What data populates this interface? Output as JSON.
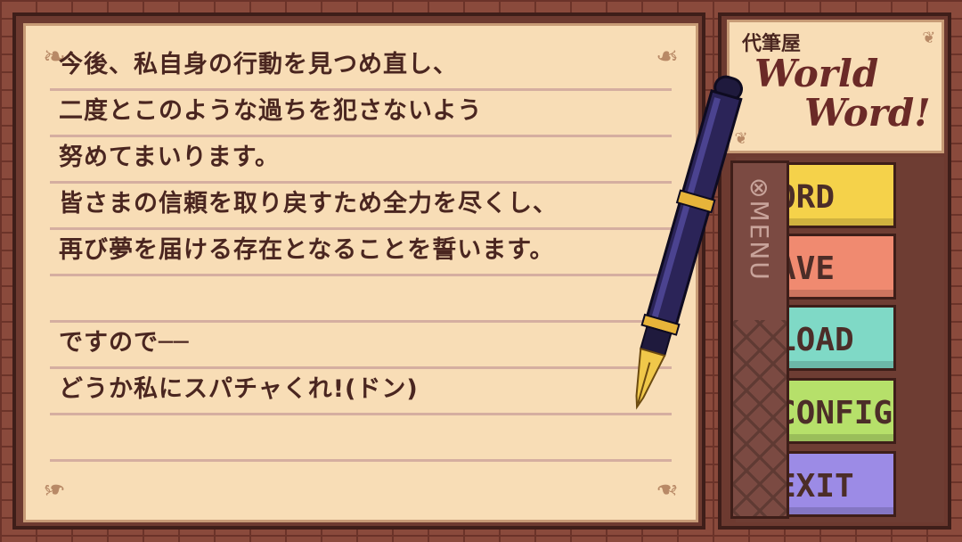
{
  "letter": {
    "lines": [
      "今後、私自身の行動を見つめ直し、",
      "二度とこのような過ちを犯さないよう",
      "努めてまいります。",
      "皆さまの信頼を取り戻すため全力を尽くし、",
      "再び夢を届ける存在となることを誓います。",
      "",
      "ですので──",
      "どうか私にスパチャくれ!(ドン)",
      ""
    ]
  },
  "brand": {
    "sub": "代筆屋",
    "main_line1": "World",
    "main_line2": "Word!"
  },
  "menu": {
    "label": "⊗MENU",
    "items": [
      {
        "label": "WORD",
        "visible": "ORD",
        "color": "#f5d24a"
      },
      {
        "label": "SAVE",
        "visible": "AVE",
        "color": "#f08a70"
      },
      {
        "label": "LOAD",
        "visible": "LOAD",
        "color": "#7fd9c6"
      },
      {
        "label": "CONFIG",
        "visible": "CONFIG",
        "color": "#b6e06a"
      },
      {
        "label": "EXIT",
        "visible": "EXIT",
        "color": "#9c8be6"
      }
    ]
  },
  "colors": {
    "paper": "#f8ddb6",
    "ink": "#4a2620",
    "frame": "#6d3a30"
  }
}
